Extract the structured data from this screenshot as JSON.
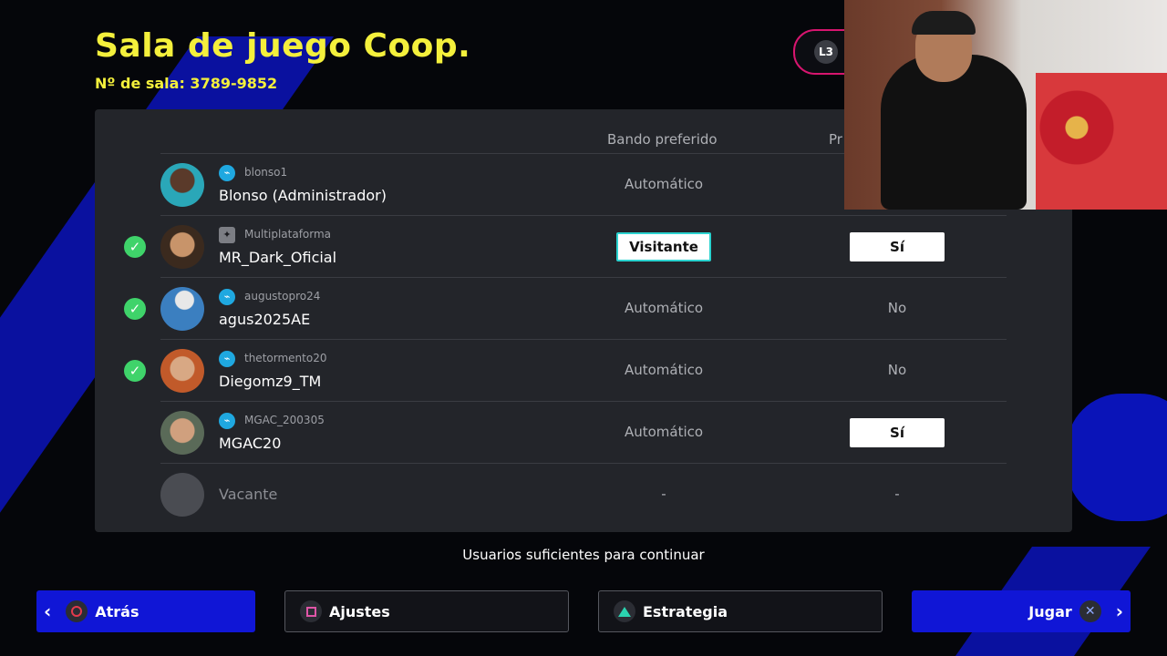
{
  "header": {
    "title": "Sala de juego Coop.",
    "room_number": "Nº de sala: 3789-9852",
    "l3_label": "L3"
  },
  "table": {
    "columns": [
      "Bando preferido",
      "Pr"
    ],
    "rows": [
      {
        "ready": false,
        "platform": "PlayStation",
        "account": "blonso1",
        "name": "Blonso (Administrador)",
        "side": "Automático",
        "side_selected": false,
        "pref": "",
        "pref_boxed": false
      },
      {
        "ready": true,
        "platform": "Multiplataforma",
        "account": "Multiplataforma",
        "name": "MR_Dark_Oficial",
        "side": "Visitante",
        "side_selected": true,
        "pref": "Sí",
        "pref_boxed": true
      },
      {
        "ready": true,
        "platform": "PlayStation",
        "account": "augustopro24",
        "name": "agus2025AE",
        "side": "Automático",
        "side_selected": false,
        "pref": "No",
        "pref_boxed": false
      },
      {
        "ready": true,
        "platform": "PlayStation",
        "account": "thetormento20",
        "name": "Diegomz9_TM",
        "side": "Automático",
        "side_selected": false,
        "pref": "No",
        "pref_boxed": false
      },
      {
        "ready": false,
        "platform": "PlayStation",
        "account": "MGAC_200305",
        "name": "MGAC20",
        "side": "Automático",
        "side_selected": false,
        "pref": "Sí",
        "pref_boxed": true
      },
      {
        "ready": false,
        "platform": "",
        "account": "",
        "name": "Vacante",
        "side": "-",
        "side_selected": false,
        "pref": "-",
        "pref_boxed": false
      }
    ]
  },
  "status_text": "Usuarios suficientes para continuar",
  "buttons": {
    "back": "Atrás",
    "settings": "Ajustes",
    "strategy": "Estrategia",
    "play": "Jugar"
  },
  "icons": {
    "psn": "playstation-icon",
    "multiplatform": "gamepad-icon",
    "ready": "check-icon"
  },
  "colors": {
    "title": "#f4f03c",
    "accent_blue": "#1016d6",
    "ready_green": "#3fd36a",
    "selection_cyan": "#2bd3d0"
  }
}
